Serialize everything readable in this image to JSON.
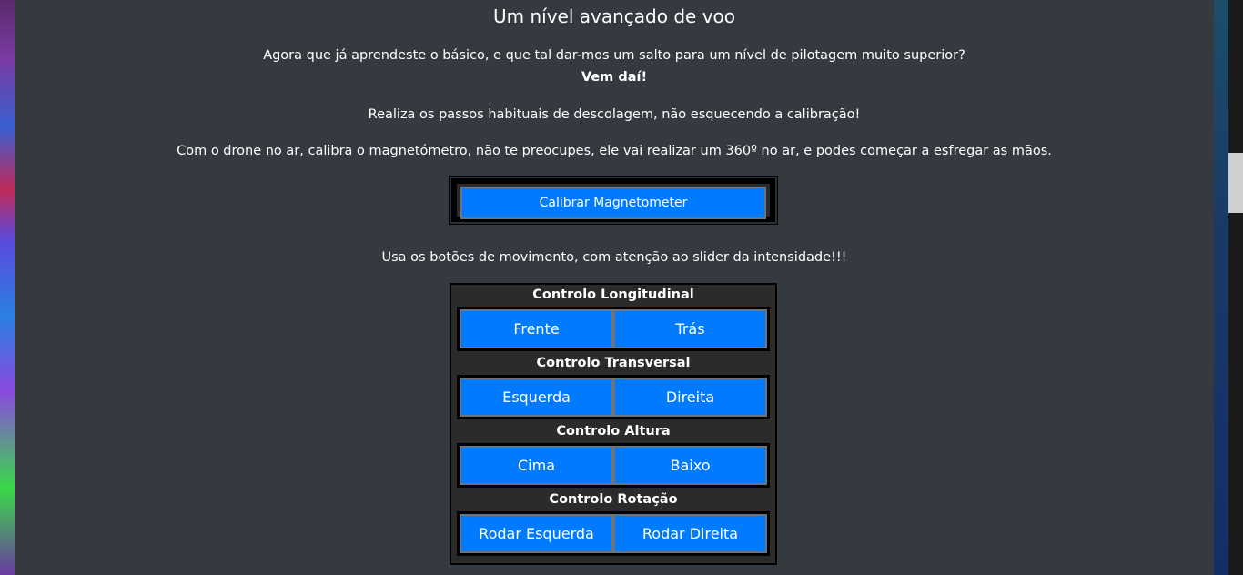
{
  "page": {
    "title": "Um nível avançado de voo",
    "paragraph1": "Agora que já aprendeste o básico, e que tal dar-mos um salto para um nível de pilotagem muito superior?",
    "paragraph1_bold": "Vem daí!",
    "paragraph2": "Realiza os passos habituais de descolagem, não esquecendo a calibração!",
    "paragraph3": "Com o drone no ar, calibra o magnetómetro, não te preocupes, ele vai realizar um 360º no ar, e podes começar a esfregar as mãos.",
    "calibrate_button": "Calibrar Magnetometer",
    "paragraph4": "Usa os botões de movimento, com atenção ao slider da intensidade!!!"
  },
  "controls": [
    {
      "label": "Controlo Longitudinal",
      "left": "Frente",
      "right": "Trás"
    },
    {
      "label": "Controlo Transversal",
      "left": "Esquerda",
      "right": "Direita"
    },
    {
      "label": "Controlo Altura",
      "left": "Cima",
      "right": "Baixo"
    },
    {
      "label": "Controlo Rotação",
      "left": "Rodar Esquerda",
      "right": "Rodar Direita"
    }
  ],
  "colors": {
    "panel": "#343a40",
    "button": "#007bff",
    "button_border": "#6c757d"
  }
}
